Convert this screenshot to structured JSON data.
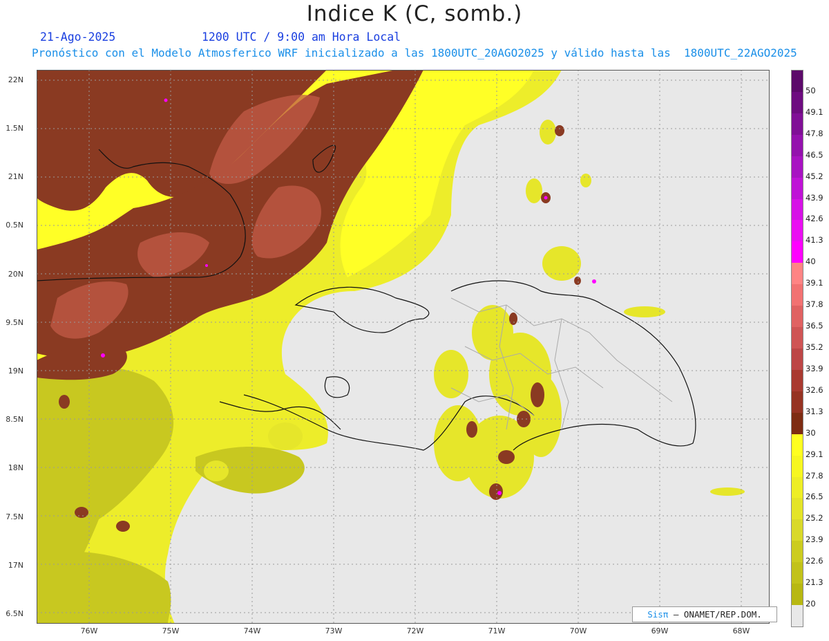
{
  "title": "Indice K (C, somb.)",
  "date": "21-Ago-2025",
  "time": "1200 UTC / 9:00 am Hora Local",
  "description": "Pronóstico con el Modelo Atmosferico WRF inicializado a las 1800UTC_20AGO2025 y válido hasta las  1800UTC_22AGO2025",
  "lat_labels": [
    "22N",
    "1.5N",
    "21N",
    "0.5N",
    "20N",
    "9.5N",
    "19N",
    "8.5N",
    "18N",
    "7.5N",
    "17N",
    "6.5N"
  ],
  "lon_labels": [
    "76W",
    "75W",
    "74W",
    "73W",
    "72W",
    "71W",
    "70W",
    "69W",
    "68W"
  ],
  "colorbar": {
    "labels": [
      "50",
      "49.1",
      "47.8",
      "46.5",
      "45.2",
      "43.9",
      "42.6",
      "41.3",
      "40",
      "39.1",
      "37.8",
      "36.5",
      "35.2",
      "33.9",
      "32.6",
      "31.3",
      "30",
      "29.1",
      "27.8",
      "26.5",
      "25.2",
      "23.9",
      "22.6",
      "21.3",
      "20"
    ],
    "colors": [
      "#5c0a6a",
      "#6e0c80",
      "#800f96",
      "#9411ad",
      "#a812c2",
      "#bf12d6",
      "#d611e6",
      "#ea0ef2",
      "#ff00ff",
      "#ff8484",
      "#f27272",
      "#e06262",
      "#cf5454",
      "#bd4646",
      "#a93a30",
      "#963322",
      "#7e2c12",
      "#ffff20",
      "#f7f720",
      "#eeee25",
      "#e4e428",
      "#d9d92a",
      "#cccc20",
      "#c2c21a",
      "#b8b812",
      "#e8e8e8"
    ]
  },
  "credit": {
    "sis": "Sisπ",
    "org": "– ONAMET/REP.DOM."
  },
  "colors": {
    "background": "#e8e8e8",
    "dark_brown": "#8a3a22",
    "salmon": "#c8604c",
    "yellow": "#ffff26",
    "olive": "#cccc22",
    "magenta": "#ff00ff"
  }
}
